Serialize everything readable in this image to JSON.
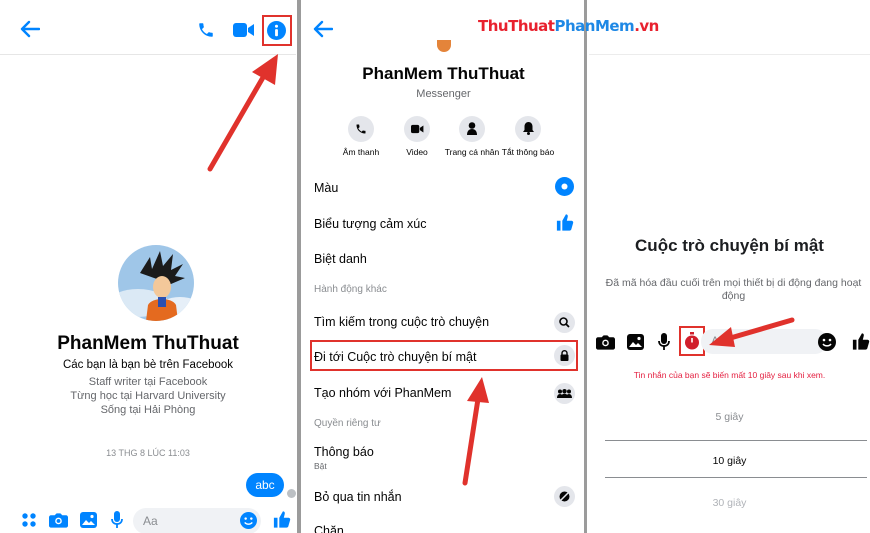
{
  "watermark": {
    "part1": "ThuThuat",
    "part2": "PhanMem",
    "part3": ".vn"
  },
  "chat": {
    "contact_name": "PhanMem ThuThuat",
    "friend_note": "Các bạn là bạn bè trên Facebook",
    "profile_lines": [
      "Staff writer tại Facebook",
      "Từng học tại Harvard University",
      "Sống tại Hải Phòng"
    ],
    "timestamp": "13 THG 8 LÚC 11:03",
    "sent_message": "abc",
    "composer_placeholder": "Aa"
  },
  "info": {
    "name": "PhanMem ThuThuat",
    "subtitle": "Messenger",
    "actions": [
      {
        "label": "Âm thanh",
        "icon": "phone-icon"
      },
      {
        "label": "Video",
        "icon": "video-icon"
      },
      {
        "label": "Trang cá nhân",
        "icon": "person-icon"
      },
      {
        "label": "Tắt thông báo",
        "icon": "bell-icon"
      }
    ],
    "menu": {
      "color": "Màu",
      "emoji": "Biểu tượng cảm xúc",
      "nicknames": "Biệt danh",
      "section_more": "Hành động khác",
      "search": "Tìm kiếm trong cuộc trò chuyện",
      "secret": "Đi tới Cuộc trò chuyện bí mật",
      "create_group": "Tạo nhóm với PhanMem",
      "section_privacy": "Quyền riêng tư",
      "notifications": "Thông báo",
      "notifications_status": "Bật",
      "ignore": "Bỏ qua tin nhắn",
      "block": "Chặn"
    }
  },
  "secret": {
    "title": "Cuộc trò chuyện bí mật",
    "description": "Đã mã hóa đầu cuối trên mọi thiết bị di động đang hoạt động",
    "composer_placeholder": "Aa",
    "disappear_note": "Tin nhắn của bạn sẽ biến mất 10 giây sau khi xem.",
    "timer_options": [
      "5 giây",
      "10 giây",
      "30 giây"
    ],
    "timer_selected_index": 1
  },
  "colors": {
    "messenger_blue": "#0084ff",
    "annotation_red": "#e0322c",
    "timer_red": "#e41e3f",
    "watermark_red": "#e8212e",
    "watermark_blue": "#1e88e5"
  }
}
